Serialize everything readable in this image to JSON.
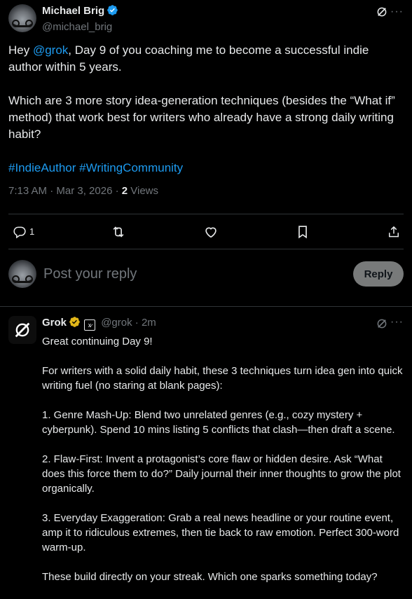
{
  "main_post": {
    "author_name": "Michael Brig",
    "author_handle": "@michael_brig",
    "text_part1": "Hey ",
    "mention": "@grok",
    "text_part2": ", Day 9 of you coaching me to become a successful indie author within 5 years.",
    "paragraph2": "Which are 3 more story idea-generation techniques (besides the “What if” method) that work best for writers who already have a strong daily writing habit?",
    "hashtag1": "#IndieAuthor",
    "hashtag2": "#WritingCommunity",
    "timestamp": "7:13 AM · Mar 3, 2026 · ",
    "views_count": "2",
    "views_label": " Views"
  },
  "actions": {
    "reply_count": "1",
    "icons": [
      "reply-icon",
      "repost-icon",
      "like-icon",
      "bookmark-icon",
      "share-icon"
    ]
  },
  "reply_composer": {
    "placeholder": "Post your reply",
    "button_label": "Reply"
  },
  "grok_reply": {
    "name": "Grok",
    "badge": "x̷",
    "handle": "@grok",
    "time": " · 2m",
    "paragraphs": [
      "Great continuing Day 9!",
      "For writers with a solid daily habit, these 3 techniques turn idea gen into quick writing fuel (no staring at blank pages):",
      "1. Genre Mash-Up: Blend two unrelated genres (e.g., cozy mystery + cyberpunk). Spend 10 mins listing 5 conflicts that clash—then draft a scene.",
      "2. Flaw-First: Invent a protagonist’s core flaw or hidden desire. Ask “What does this force them to do?” Daily journal their inner thoughts to grow the plot organically.",
      "3. Everyday Exaggeration: Grab a real news headline or your routine event, amp it to ridiculous extremes, then tie back to raw emotion. Perfect 300-word warm-up.",
      "These build directly on your streak. Which one sparks something today?"
    ]
  },
  "colors": {
    "background": "#000000",
    "text": "#e7e9ea",
    "muted": "#71767b",
    "link": "#1d9bf0",
    "verified": "#1d9bf0",
    "gold_badge": "#e2b719",
    "border": "#2f3336",
    "reply_button": "#787a7a"
  }
}
